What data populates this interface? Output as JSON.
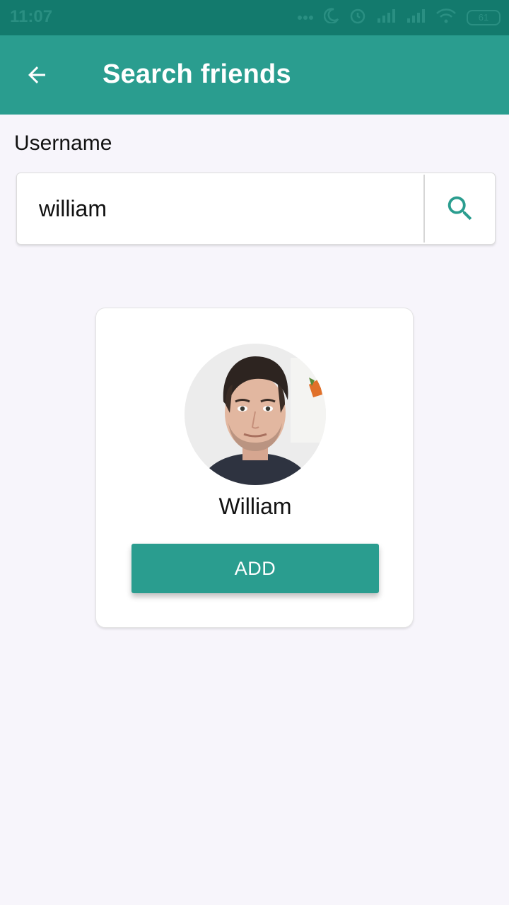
{
  "status_bar": {
    "time": "11:07",
    "battery": "61",
    "icons": [
      "more-icon",
      "moon-icon",
      "alarm-icon",
      "signal-icon",
      "signal-icon",
      "wifi-icon",
      "battery-icon"
    ]
  },
  "app_bar": {
    "title": "Search friends",
    "back_icon": "arrow-back-icon"
  },
  "search": {
    "label": "Username",
    "value": "william",
    "button_icon": "search-icon"
  },
  "result": {
    "name": "William",
    "add_label": "ADD"
  },
  "colors": {
    "primary": "#2a9d8f",
    "primary_dark": "#137a6d",
    "background": "#f7f5fb"
  }
}
